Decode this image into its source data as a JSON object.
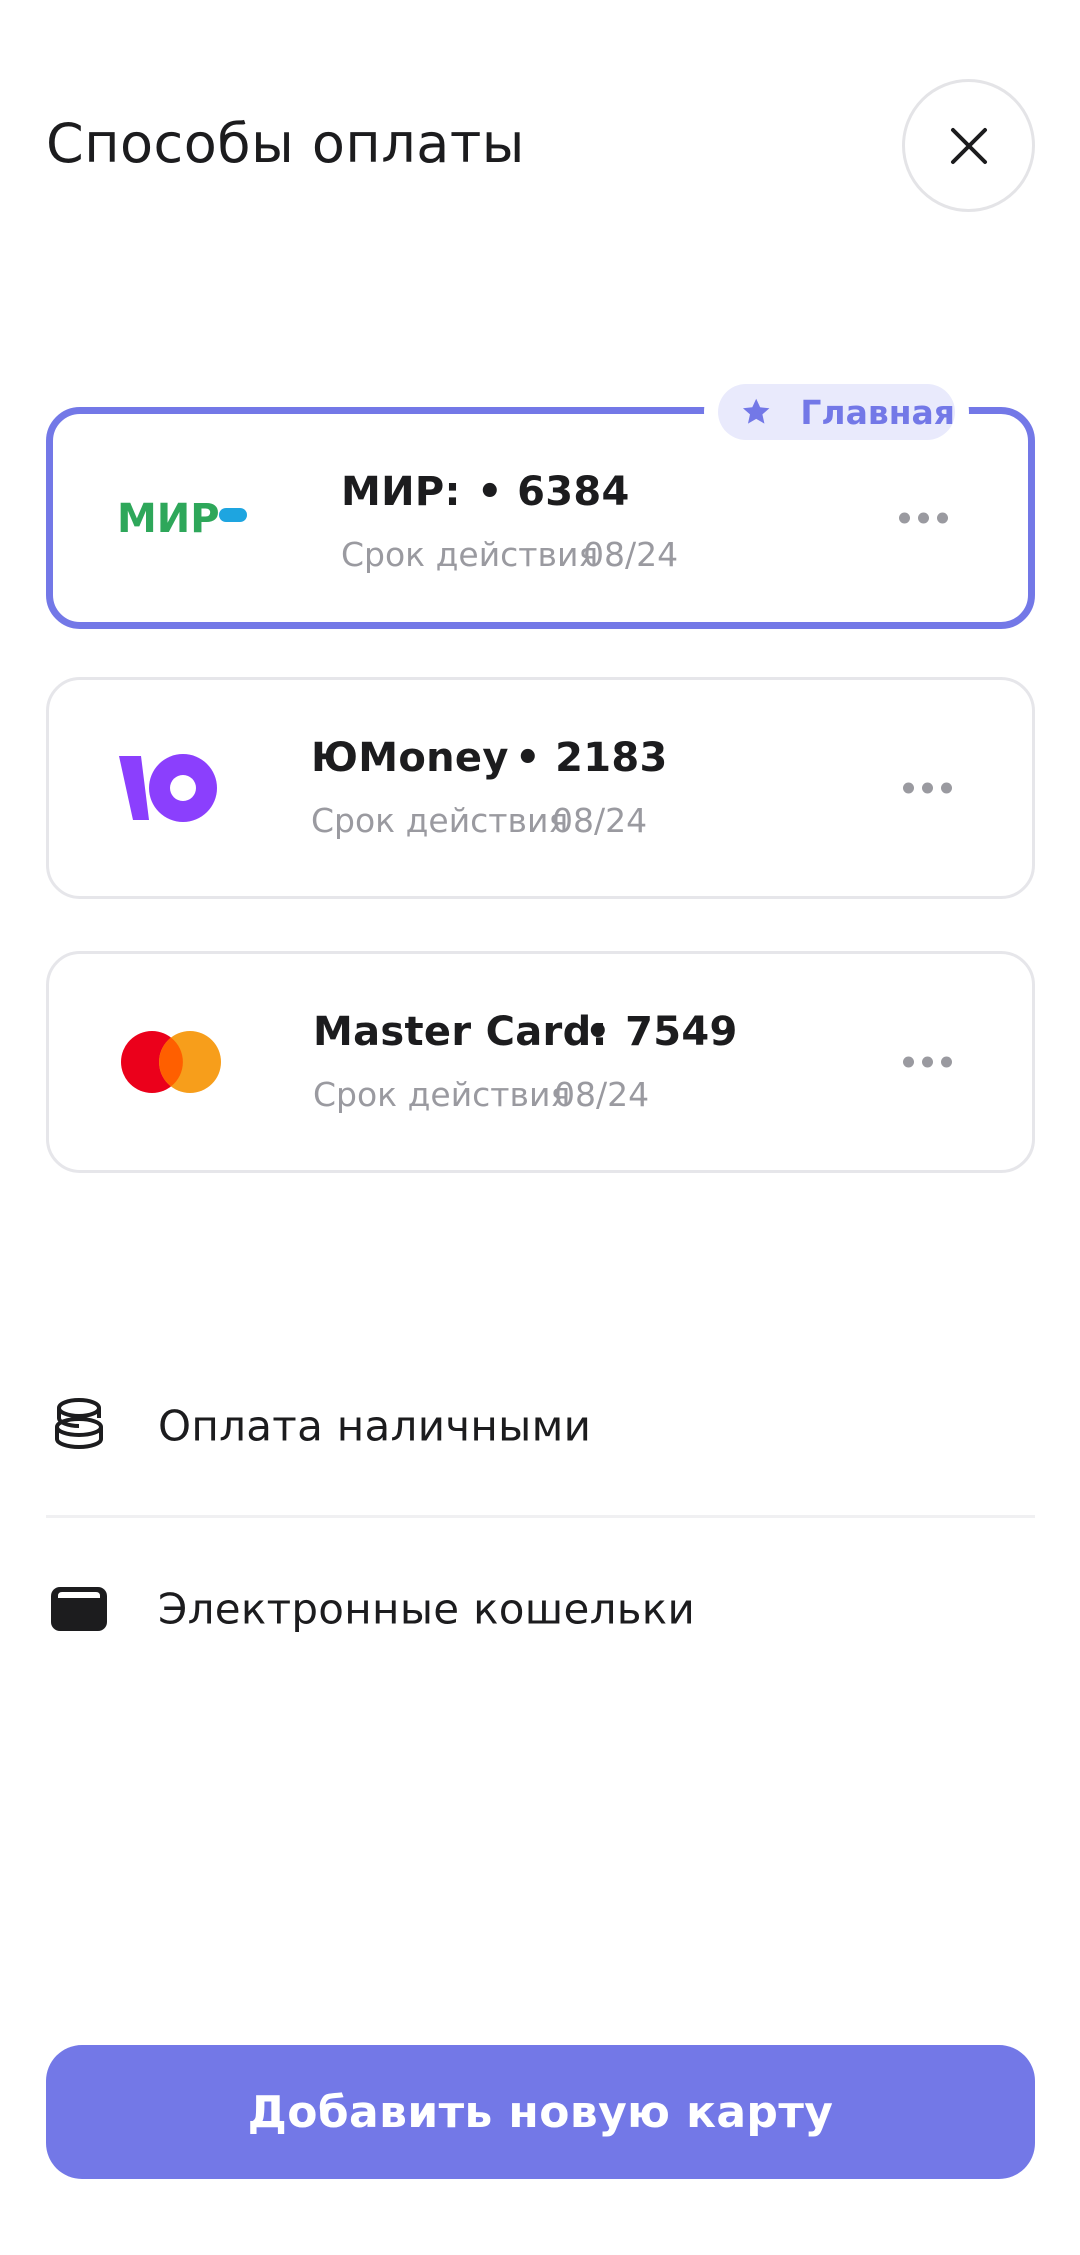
{
  "header": {
    "title": "Способы оплаты",
    "close_icon": "close-icon"
  },
  "cards": [
    {
      "name": "МИР:",
      "number": "• 6384",
      "expiry_label": "Срок действия",
      "expiry": "08/24",
      "logo_text": "МИР",
      "logo_icon": "mir-logo",
      "primary": true,
      "badge_label": "Главная",
      "badge_icon": "star-icon"
    },
    {
      "name": "ЮMoney",
      "number": "• 2183",
      "expiry_label": "Срок действия",
      "expiry": "08/24",
      "logo_icon": "yoomoney-logo",
      "primary": false
    },
    {
      "name": "Master Card:",
      "number": "• 7549",
      "expiry_label": "Срок действия",
      "expiry": "08/24",
      "logo_icon": "mastercard-logo",
      "primary": false
    }
  ],
  "options": [
    {
      "label": "Оплата наличными",
      "icon": "coins-icon"
    },
    {
      "label": "Электронные кошельки",
      "icon": "wallet-icon"
    }
  ],
  "footer": {
    "add_card_label": "Добавить новую карту"
  },
  "colors": {
    "accent": "#7378e7",
    "badge_bg": "#e9eafc",
    "mir_green": "#2ea75a",
    "mir_blue": "#1ea5e0",
    "yoomoney_purple": "#8b3ffd",
    "mastercard_red": "#eb001b",
    "mastercard_orange": "#f79e1b",
    "secondary_text": "#9a9aa0"
  }
}
